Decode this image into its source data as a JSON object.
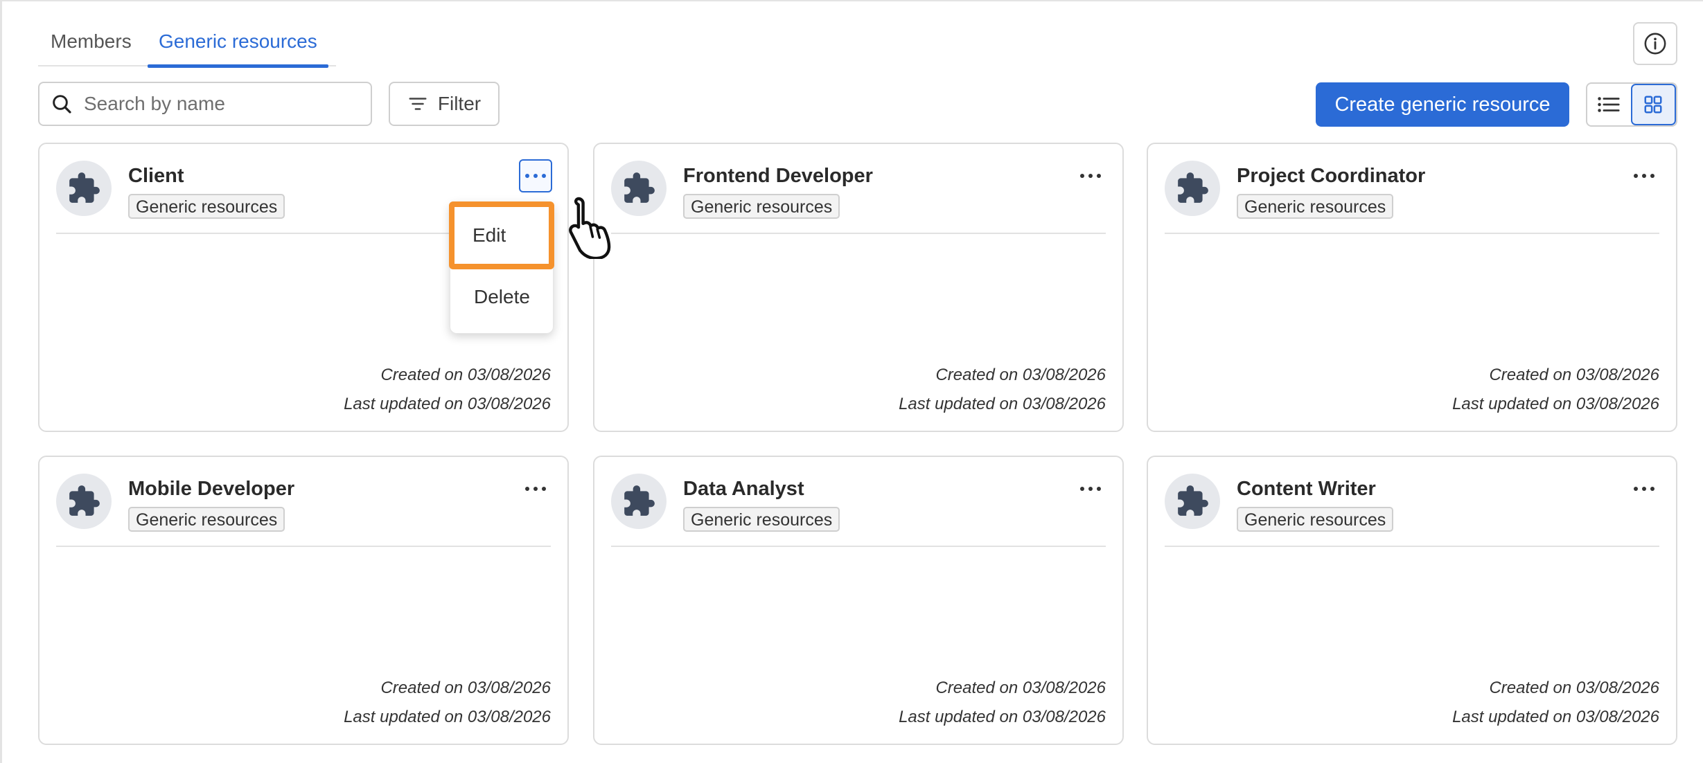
{
  "tabs": [
    {
      "label": "Members",
      "active": false
    },
    {
      "label": "Generic resources",
      "active": true
    }
  ],
  "toolbar": {
    "search_placeholder": "Search by name",
    "filter_label": "Filter",
    "create_label": "Create generic resource",
    "view_mode": "grid"
  },
  "colors": {
    "accent": "#2b6bd6",
    "highlight": "#f5922d",
    "avatar_bg": "#e6e8ec",
    "icon": "#3e4a5e"
  },
  "cards": [
    {
      "title": "Client",
      "badge": "Generic resources",
      "created": "Created on 03/08/2026",
      "updated": "Last updated on 03/08/2026",
      "menu_open": true
    },
    {
      "title": "Frontend Developer",
      "badge": "Generic resources",
      "created": "Created on 03/08/2026",
      "updated": "Last updated on 03/08/2026",
      "menu_open": false
    },
    {
      "title": "Project Coordinator",
      "badge": "Generic resources",
      "created": "Created on 03/08/2026",
      "updated": "Last updated on 03/08/2026",
      "menu_open": false
    },
    {
      "title": "Mobile Developer",
      "badge": "Generic resources",
      "created": "Created on 03/08/2026",
      "updated": "Last updated on 03/08/2026",
      "menu_open": false
    },
    {
      "title": "Data Analyst",
      "badge": "Generic resources",
      "created": "Created on 03/08/2026",
      "updated": "Last updated on 03/08/2026",
      "menu_open": false
    },
    {
      "title": "Content Writer",
      "badge": "Generic resources",
      "created": "Created on 03/08/2026",
      "updated": "Last updated on 03/08/2026",
      "menu_open": false
    }
  ],
  "menu": {
    "items": [
      {
        "label": "Edit",
        "highlighted": true
      },
      {
        "label": "Delete",
        "highlighted": false
      }
    ]
  },
  "icons": {
    "card_avatar": "puzzle-piece-icon",
    "more": "more-horizontal-icon",
    "search": "search-icon",
    "filter": "filter-icon",
    "info": "info-icon",
    "list_view": "list-view-icon",
    "grid_view": "grid-view-icon",
    "cursor": "hand-pointer-icon"
  }
}
